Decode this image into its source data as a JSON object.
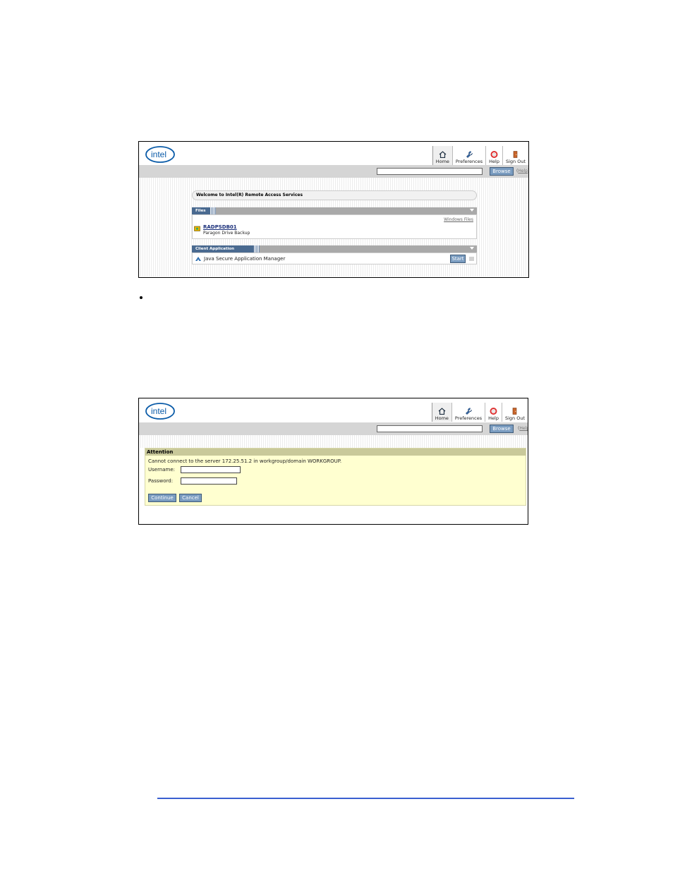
{
  "brand": {
    "logo_text": "intel",
    "accent": "#0a5ba8"
  },
  "nav": {
    "home": "Home",
    "preferences": "Preferences",
    "help": "Help",
    "signout": "Sign Out"
  },
  "search": {
    "value": "",
    "browse_label": "Browse",
    "help_label": "Help",
    "paren_open": "(",
    "paren_close": ")"
  },
  "screen1": {
    "welcome": "Welcome to Intel(R) Remote Access Services",
    "files": {
      "header": "Files",
      "windows_files_link": "Windows Files",
      "item_name": "RADPSDB01",
      "item_desc": "Paragon Drive Backup"
    },
    "sessions": {
      "header": "Client Application Sessions",
      "item_name": "Java Secure Application Manager",
      "start_label": "Start"
    }
  },
  "screen2": {
    "attention_title": "Attention",
    "message": "Cannot connect to the server 172.25.51.2 in workgroup/domain WORKGROUP.",
    "username_label": "Username:",
    "username_value": "",
    "password_label": "Password:",
    "password_value": "",
    "continue_label": "Continue",
    "cancel_label": "Cancel"
  }
}
